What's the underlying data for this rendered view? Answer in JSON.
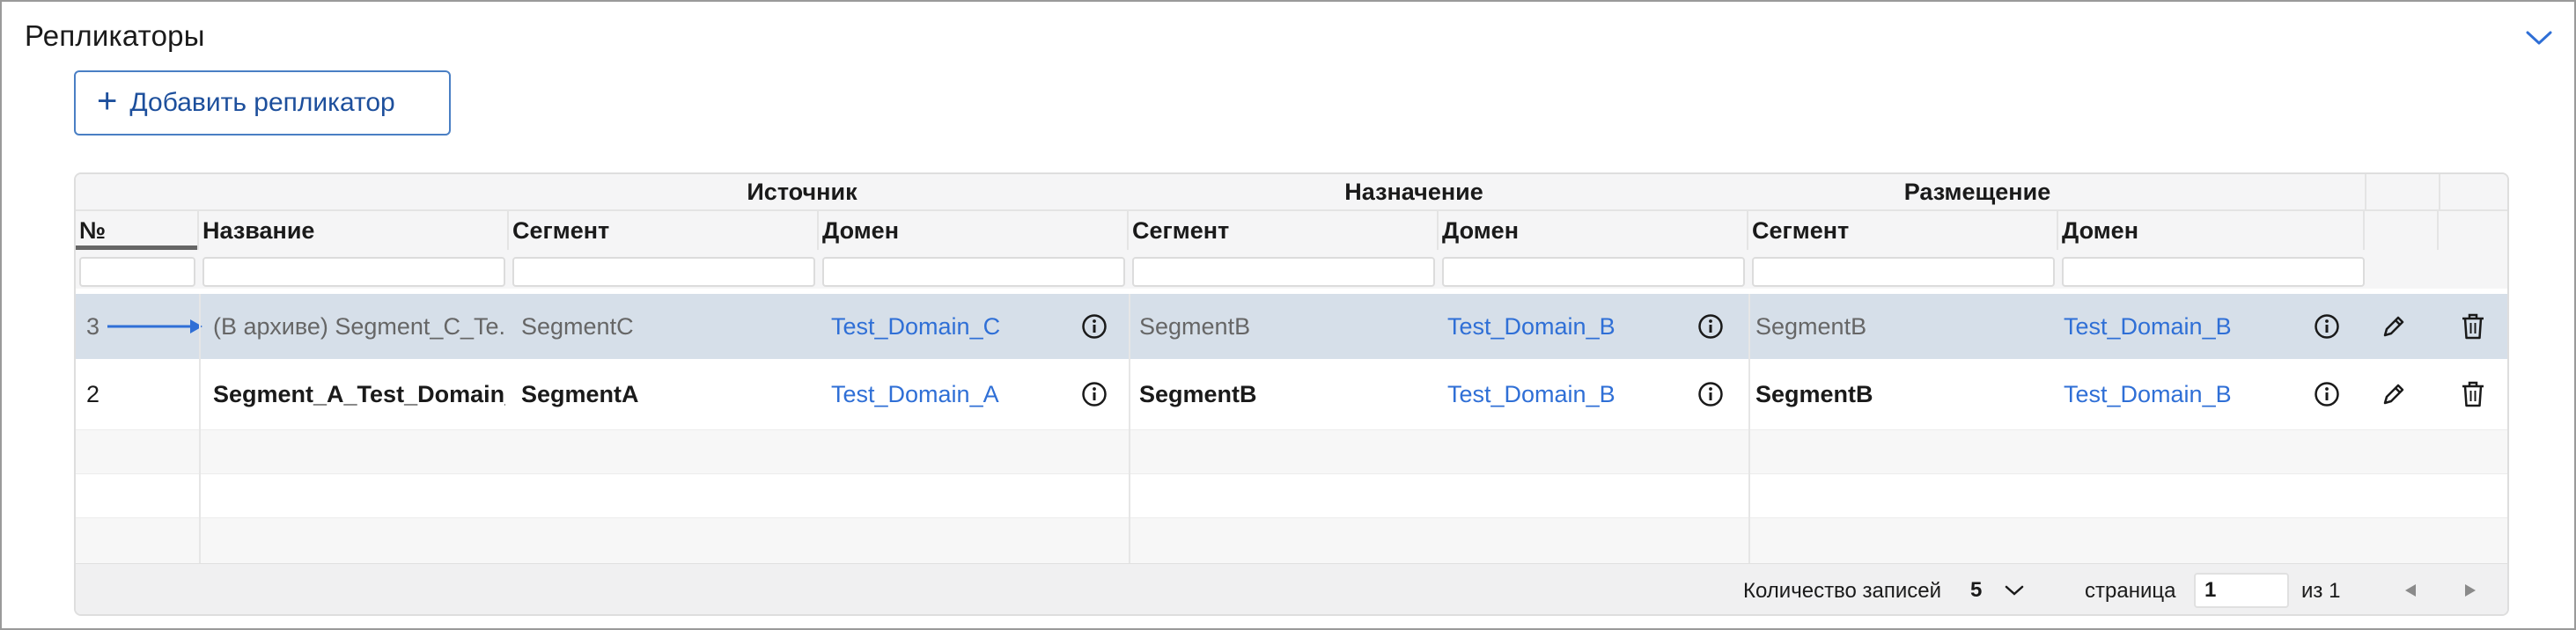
{
  "section": {
    "title": "Репликаторы",
    "collapse_icon": "chevron-down-icon"
  },
  "add_button": {
    "label": "Добавить репликатор",
    "icon": "plus-icon"
  },
  "table": {
    "groups": {
      "source": "Источник",
      "destination": "Назначение",
      "placement": "Размещение"
    },
    "columns": {
      "num": "№",
      "name": "Название",
      "src_segment": "Сегмент",
      "src_domain": "Домен",
      "dst_segment": "Сегмент",
      "dst_domain": "Домен",
      "plc_segment": "Сегмент",
      "plc_domain": "Домен"
    },
    "rows": [
      {
        "num": "3",
        "name": "(В архиве) Segment_C_Te...",
        "src_segment": "SegmentC",
        "src_domain": "Test_Domain_C",
        "dst_segment": "SegmentB",
        "dst_domain": "Test_Domain_B",
        "plc_segment": "SegmentB",
        "plc_domain": "Test_Domain_B",
        "archived": true,
        "selected": true
      },
      {
        "num": "2",
        "name": "Segment_A_Test_Domain_...",
        "src_segment": "SegmentA",
        "src_domain": "Test_Domain_A",
        "dst_segment": "SegmentB",
        "dst_domain": "Test_Domain_B",
        "plc_segment": "SegmentB",
        "plc_domain": "Test_Domain_B",
        "archived": false,
        "selected": false
      }
    ]
  },
  "footer": {
    "records_label": "Количество записей",
    "page_size": "5",
    "page_label": "страница",
    "page_value": "1",
    "of_label": "из 1",
    "prev_icon": "triangle-left-icon",
    "next_icon": "triangle-right-icon"
  },
  "colors": {
    "accent": "#2f6fd6",
    "button_text": "#1d4f9c",
    "selected_row": "#d6dfe9",
    "header_bg": "#f5f5f6"
  }
}
